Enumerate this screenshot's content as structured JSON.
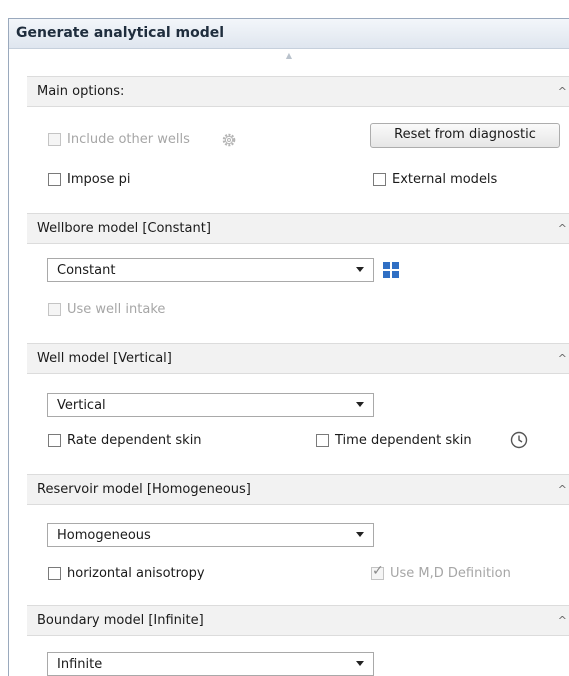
{
  "window": {
    "title": "Generate analytical model"
  },
  "main_options": {
    "header": "Main options:",
    "include_other_wells": {
      "label": "Include other wells",
      "checked": false,
      "enabled": false
    },
    "impose_pi": {
      "label": "Impose pi",
      "checked": false
    },
    "reset_button": "Reset from diagnostic",
    "external_models": {
      "label": "External models",
      "checked": false
    }
  },
  "wellbore": {
    "header": "Wellbore model [Constant]",
    "selected": "Constant",
    "use_well_intake": {
      "label": "Use well intake",
      "checked": false,
      "enabled": false
    }
  },
  "well": {
    "header": "Well model [Vertical]",
    "selected": "Vertical",
    "rate_dependent_skin": {
      "label": "Rate dependent skin",
      "checked": false
    },
    "time_dependent_skin": {
      "label": "Time dependent skin",
      "checked": false
    }
  },
  "reservoir": {
    "header": "Reservoir model [Homogeneous]",
    "selected": "Homogeneous",
    "horizontal_anisotropy": {
      "label": "horizontal anisotropy",
      "checked": false
    },
    "use_md_definition": {
      "label": "Use M,D Definition",
      "checked": true,
      "enabled": false
    }
  },
  "boundary": {
    "header": "Boundary model [Infinite]",
    "selected": "Infinite"
  },
  "colors": {
    "accent_icon": "#2f6fc4",
    "header_bg": "#f2f2f2",
    "title_bg": "#dfe6ef"
  }
}
